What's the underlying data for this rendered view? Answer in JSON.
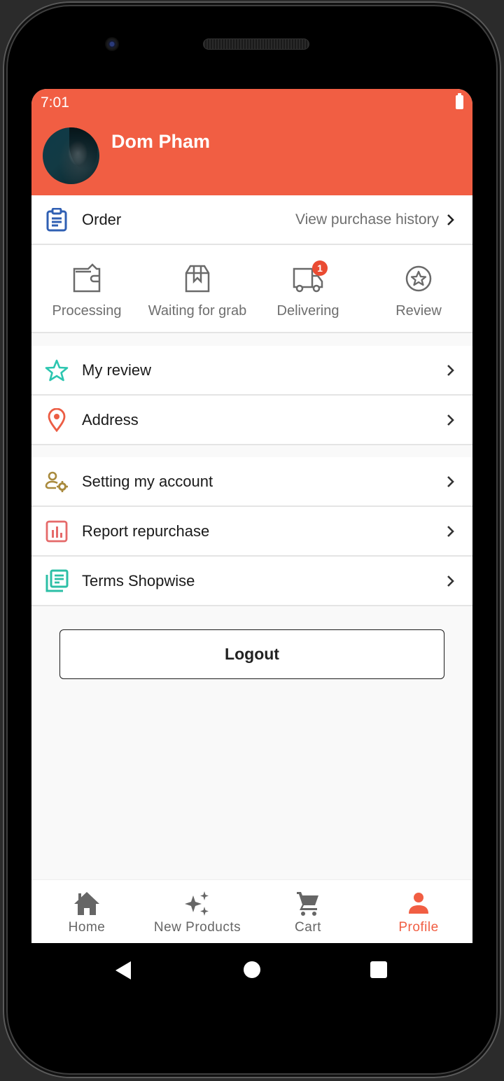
{
  "status_bar": {
    "time": "7:01",
    "battery_icon": "battery-full-icon"
  },
  "profile": {
    "name": "Dom Pham",
    "avatar": "user-avatar-photo"
  },
  "order": {
    "label": "Order",
    "icon": "clipboard-list-icon",
    "link_text": "View purchase history",
    "link_icon": "chevron-right-icon"
  },
  "order_statuses": [
    {
      "label": "Processing",
      "icon": "wallet-icon",
      "badge": null
    },
    {
      "label": "Waiting for grab",
      "icon": "package-box-icon",
      "badge": null
    },
    {
      "label": "Delivering",
      "icon": "delivery-truck-icon",
      "badge": "1"
    },
    {
      "label": "Review",
      "icon": "star-circle-icon",
      "badge": null
    }
  ],
  "menu_group_1": [
    {
      "label": "My review",
      "icon": "star-outline-icon"
    },
    {
      "label": "Address",
      "icon": "location-pin-icon"
    }
  ],
  "menu_group_2": [
    {
      "label": "Setting my account",
      "icon": "user-settings-icon"
    },
    {
      "label": "Report repurchase",
      "icon": "bar-chart-icon"
    },
    {
      "label": "Terms Shopwise",
      "icon": "document-stack-icon"
    }
  ],
  "logout": {
    "label": "Logout"
  },
  "bottom_nav": [
    {
      "label": "Home",
      "icon": "home-icon",
      "active": false
    },
    {
      "label": "New Products",
      "icon": "sparkles-icon",
      "active": false
    },
    {
      "label": "Cart",
      "icon": "cart-icon",
      "active": false
    },
    {
      "label": "Profile",
      "icon": "person-icon",
      "active": true
    }
  ],
  "colors": {
    "brand": "#f15e43",
    "badge": "#ea4b32",
    "order_icon": "#2f5fb3",
    "review_icon": "#2cc6b0",
    "address_icon": "#ec5d44",
    "settings_icon": "#a98a3d",
    "report_icon": "#e56a6a",
    "terms_icon": "#2cbfa6",
    "inactive": "#666666"
  }
}
